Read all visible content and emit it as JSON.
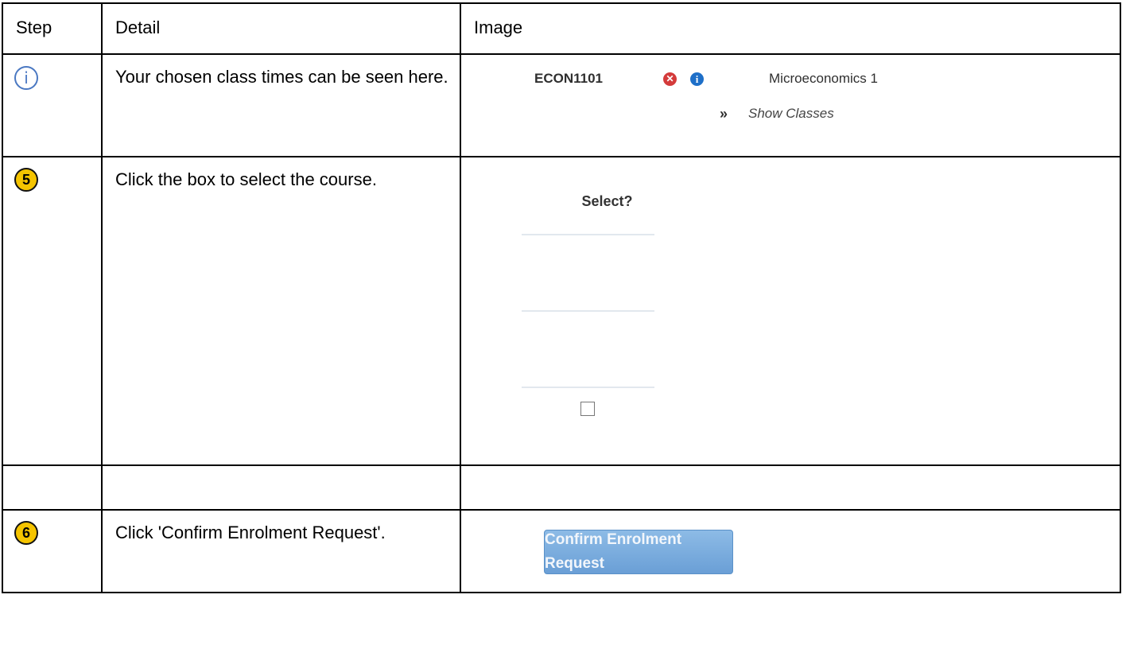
{
  "headers": {
    "step": "Step",
    "detail": "Detail",
    "image": "Image"
  },
  "rows": [
    {
      "step_icon": "info-circle-icon",
      "step_glyph": "i",
      "detail": "Your chosen class times can be seen here.",
      "image": {
        "course_code": "ECON1101",
        "remove_icon": "x-circle-icon",
        "remove_glyph": "✕",
        "info_icon": "info-circle-icon",
        "info_glyph": "i",
        "course_name": "Microeconomics 1",
        "chevron_glyph": "»",
        "show_classes": "Show Classes"
      }
    },
    {
      "step_number": "5",
      "detail": "Click the box to select the course.",
      "image": {
        "select_label": "Select?",
        "checkbox_checked": false
      }
    },
    {
      "detail": "",
      "image": null
    },
    {
      "step_number": "6",
      "detail": "Click 'Confirm Enrolment Request'.",
      "image": {
        "button_label": "Confirm Enrolment Request"
      }
    }
  ],
  "colors": {
    "badge_fill": "#f5c400",
    "info_outline": "#4a78c2",
    "remove_red": "#d43b3b",
    "info_blue": "#1e6fc8",
    "button_blue": "#7aaee0"
  }
}
